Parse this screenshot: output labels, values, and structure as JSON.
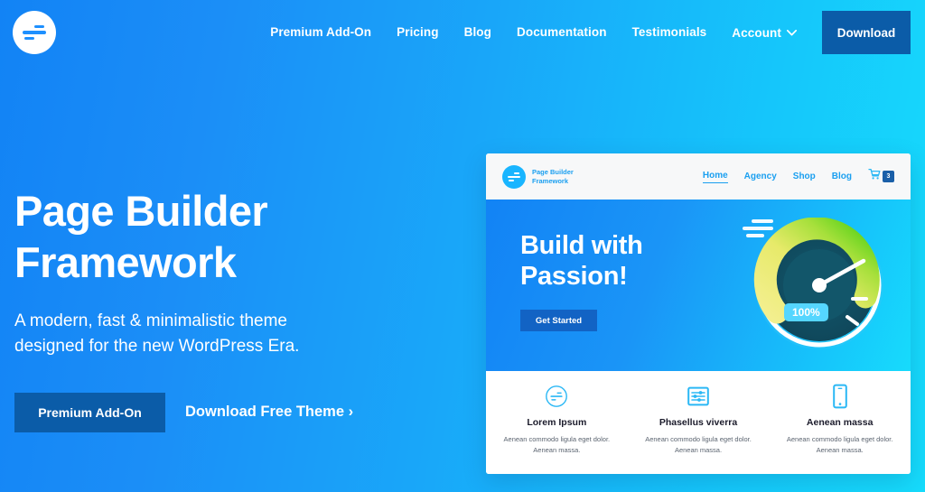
{
  "site": {
    "brand_logo_icon": "equals-divide-circle-icon",
    "nav": [
      {
        "label": "Premium Add-On",
        "has_caret": false
      },
      {
        "label": "Pricing",
        "has_caret": false
      },
      {
        "label": "Blog",
        "has_caret": false
      },
      {
        "label": "Documentation",
        "has_caret": false
      },
      {
        "label": "Testimonials",
        "has_caret": false
      },
      {
        "label": "Account",
        "has_caret": true
      }
    ],
    "download_button": "Download"
  },
  "hero": {
    "title": "Page Builder Framework",
    "subtitle": "A modern, fast & minimalistic theme designed for the new WordPress Era.",
    "primary_button": "Premium Add-On",
    "secondary_link": "Download Free Theme ›"
  },
  "mockup": {
    "brand_name": "Page Builder\nFramework",
    "nav": [
      {
        "label": "Home",
        "active": true
      },
      {
        "label": "Agency",
        "active": false
      },
      {
        "label": "Shop",
        "active": false
      },
      {
        "label": "Blog",
        "active": false
      }
    ],
    "cart_icon": "shopping-cart-icon",
    "cart_count": "3",
    "hero_title": "Build with\nPassion!",
    "hero_button": "Get Started",
    "gauge": {
      "value_label": "100%",
      "icon": "speedometer-icon"
    },
    "features": [
      {
        "icon": "equals-divide-circle-icon",
        "title": "Lorem Ipsum",
        "text": "Aenean commodo ligula eget dolor. Aenean massa."
      },
      {
        "icon": "sliders-settings-icon",
        "title": "Phasellus viverra",
        "text": "Aenean commodo ligula eget dolor. Aenean massa."
      },
      {
        "icon": "mobile-phone-icon",
        "title": "Aenean massa",
        "text": "Aenean commodo ligula eget dolor. Aenean massa."
      }
    ]
  },
  "colors": {
    "gradient_start": "#1283f5",
    "gradient_end": "#16dcfc",
    "button_dark_blue": "#0b5ca8",
    "mockup_accent": "#1a9ff0",
    "gauge_face": "#114f63",
    "gauge_arc_start": "#f4e97a",
    "gauge_arc_end": "#5fd321",
    "badge_blue": "#55d6ff"
  }
}
